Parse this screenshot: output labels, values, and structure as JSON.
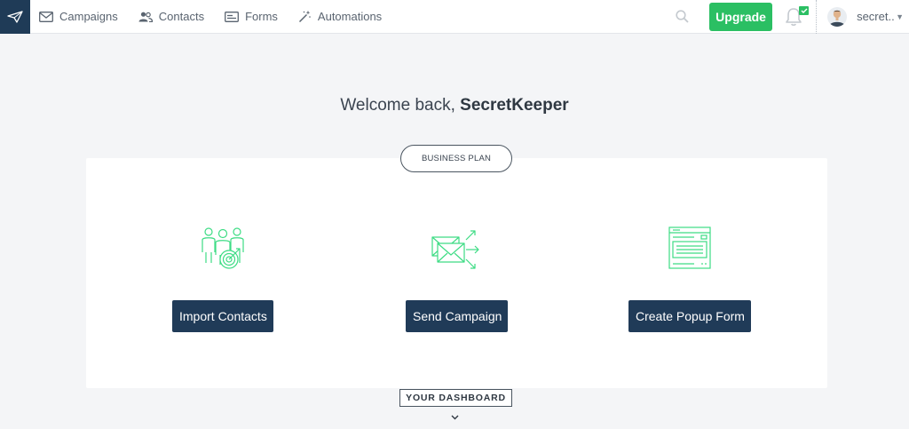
{
  "nav": {
    "items": [
      {
        "label": "Campaigns",
        "icon": "envelope-icon"
      },
      {
        "label": "Contacts",
        "icon": "people-icon"
      },
      {
        "label": "Forms",
        "icon": "form-icon"
      },
      {
        "label": "Automations",
        "icon": "magic-wand-icon"
      }
    ]
  },
  "header": {
    "upgrade_label": "Upgrade",
    "username": "secret...",
    "accent_color": "#2bbf63",
    "brand_color": "#1f3b57"
  },
  "main": {
    "welcome_prefix": "Welcome back, ",
    "welcome_name": "SecretKeeper",
    "plan_label": "BUSINESS PLAN",
    "actions": [
      {
        "label": "Import Contacts",
        "icon": "contacts-target-icon"
      },
      {
        "label": "Send Campaign",
        "icon": "send-mail-icon"
      },
      {
        "label": "Create Popup Form",
        "icon": "popup-form-icon"
      }
    ],
    "dashboard_label": "YOUR DASHBOARD"
  }
}
